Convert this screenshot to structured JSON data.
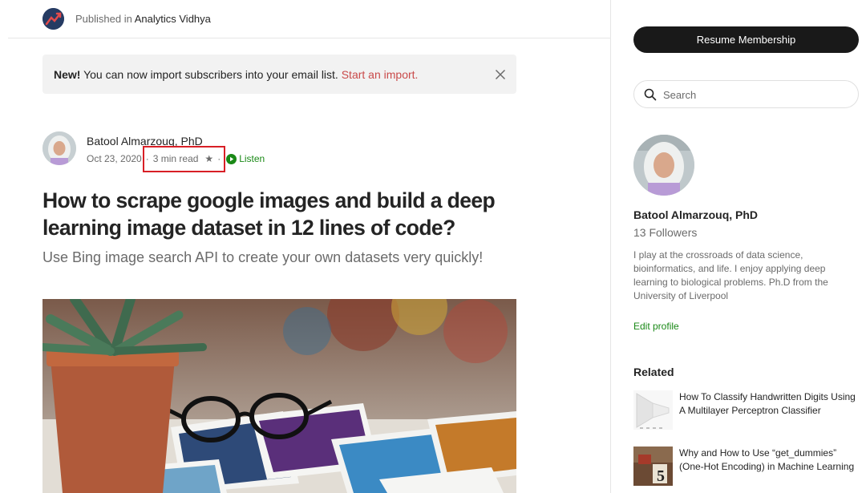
{
  "publication": {
    "prefix": "Published in",
    "name": "Analytics Vidhya"
  },
  "banner": {
    "new_label": "New!",
    "message": " You can now import subscribers into your email list. ",
    "link": "Start an import."
  },
  "author": {
    "name": "Batool Almarzouq, PhD",
    "date": "Oct 23, 2020",
    "read_time": "3 min read",
    "star": "★",
    "separator": "·",
    "listen_label": "Listen"
  },
  "article": {
    "title": "How to scrape google images and build a deep learning image dataset in 12 lines of code?",
    "subtitle": "Use Bing image search API to create your own datasets very quickly!"
  },
  "sidebar": {
    "resume_button": "Resume Membership",
    "search_placeholder": "Search",
    "profile": {
      "name": "Batool Almarzouq, PhD",
      "followers": "13 Followers",
      "bio": "I play at the crossroads of data science, bioinformatics, and life. I enjoy applying deep learning to biological problems. Ph.D from the University of Liverpool",
      "edit_link": "Edit profile"
    },
    "related": {
      "heading": "Related",
      "items": [
        {
          "title": "How To Classify Handwritten Digits Using A Multilayer Perceptron Classifier"
        },
        {
          "title": "Why and How to Use “get_dummies” (One-Hot Encoding) in Machine Learning"
        }
      ]
    }
  },
  "colors": {
    "accent_green": "#1a8917",
    "banner_link_red": "#c94a4a",
    "highlight_red": "#d81f26",
    "button_dark": "#191919"
  },
  "icons": {
    "close": "close-icon",
    "search": "search-icon",
    "listen": "play-circle-icon"
  }
}
